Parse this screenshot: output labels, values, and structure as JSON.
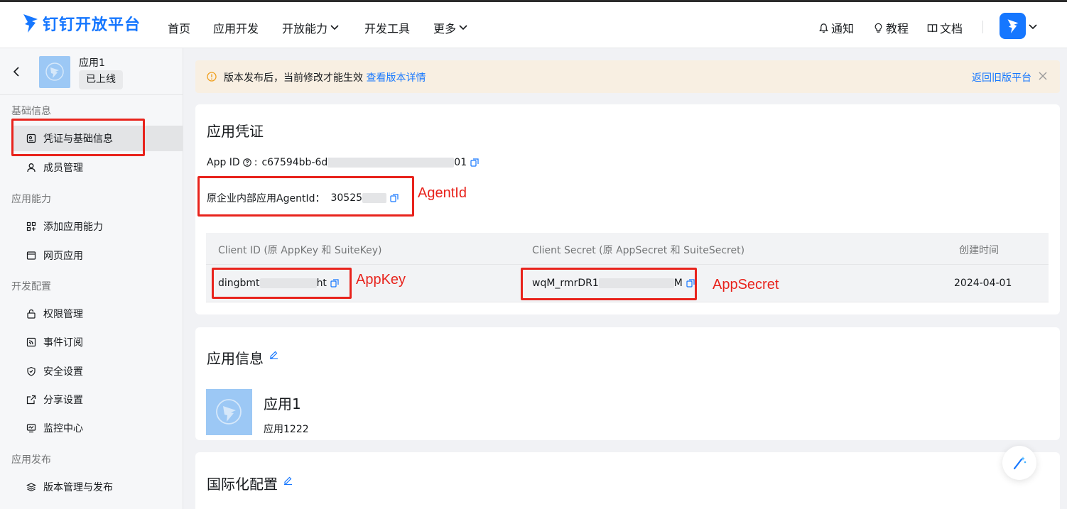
{
  "header": {
    "brand": "钉钉开放平台",
    "nav": [
      {
        "label": "首页"
      },
      {
        "label": "应用开发"
      },
      {
        "label": "开放能力"
      },
      {
        "label": "开发工具"
      },
      {
        "label": "更多"
      }
    ],
    "right": {
      "notify": "通知",
      "tutorial": "教程",
      "docs": "文档"
    }
  },
  "sidebar": {
    "app_name": "应用1",
    "app_status": "已上线",
    "groups": [
      {
        "label": "基础信息",
        "items": [
          {
            "label": "凭证与基础信息",
            "icon": "credential-icon",
            "active": true
          },
          {
            "label": "成员管理",
            "icon": "user-icon"
          }
        ]
      },
      {
        "label": "应用能力",
        "items": [
          {
            "label": "添加应用能力",
            "icon": "apps-icon"
          },
          {
            "label": "网页应用",
            "icon": "browser-icon"
          }
        ]
      },
      {
        "label": "开发配置",
        "items": [
          {
            "label": "权限管理",
            "icon": "lock-icon"
          },
          {
            "label": "事件订阅",
            "icon": "rss-icon"
          },
          {
            "label": "安全设置",
            "icon": "shield-icon"
          },
          {
            "label": "分享设置",
            "icon": "share-icon"
          },
          {
            "label": "监控中心",
            "icon": "monitor-icon"
          }
        ]
      },
      {
        "label": "应用发布",
        "items": [
          {
            "label": "版本管理与发布",
            "icon": "layers-icon"
          }
        ]
      }
    ]
  },
  "notice": {
    "text": "版本发布后，当前修改才能生效",
    "link": "查看版本详情",
    "back": "返回旧版平台"
  },
  "credentials": {
    "title": "应用凭证",
    "app_id_label": "App ID",
    "app_id_prefix": "c67594bb-6d",
    "app_id_suffix": "01",
    "agent_label": "原企业内部应用AgentId：",
    "agent_prefix": "30525",
    "table": {
      "headers": [
        "Client ID (原 AppKey 和 SuiteKey)",
        "Client Secret (原 AppSecret 和 SuiteSecret)",
        "创建时间"
      ],
      "client_id_prefix": "dingbmt",
      "client_id_suffix": "ht",
      "secret_prefix": "wqM_rmrDR1",
      "secret_suffix": "M",
      "created": "2024-04-01"
    }
  },
  "annotations": {
    "agent": "AgentId",
    "appkey": "AppKey",
    "appsecret": "AppSecret"
  },
  "app_info": {
    "title": "应用信息",
    "name": "应用1",
    "desc": "应用1222"
  },
  "i18n": {
    "title": "国际化配置"
  },
  "colors": {
    "accent": "#1677ff",
    "annotation": "#e8231c",
    "notice_bg": "#f8efe2"
  }
}
